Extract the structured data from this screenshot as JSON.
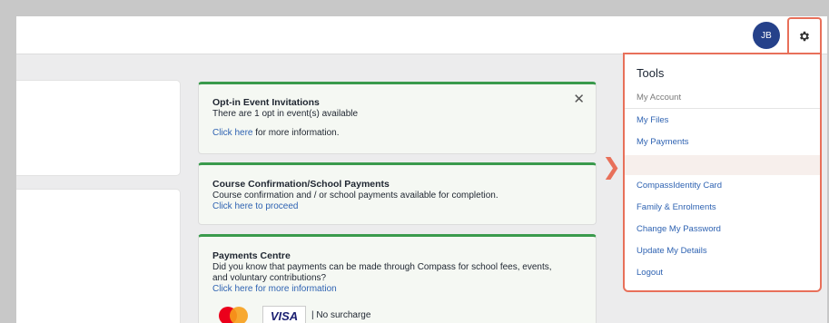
{
  "header": {
    "avatar_initials": "JB",
    "settings_icon": "gear-icon"
  },
  "notices": [
    {
      "title": "Opt-in Event Invitations",
      "body": "There are 1 opt in event(s) available",
      "link": "Click here",
      "link_suffix": " for more information.",
      "close": "✕"
    },
    {
      "title": "Course Confirmation/School Payments",
      "body": "Course confirmation and / or school payments available for completion.",
      "link": "Click here to proceed"
    },
    {
      "title": "Payments Centre",
      "body": "Did you know that payments can be made through Compass for school fees, events, and voluntary contributions?",
      "link": "Click here for more information",
      "card_note": "| No surcharge",
      "visa_label": "VISA"
    }
  ],
  "tools_menu": {
    "title": "Tools",
    "section": "My Account",
    "items": [
      "My Files",
      "My Payments",
      "",
      "CompassIdentity Card",
      "Family & Enrolments",
      "Change My Password",
      "Update My Details",
      "Logout"
    ]
  },
  "colors": {
    "accent": "#e8705a",
    "link": "#2f63b2",
    "notice_border": "#3a9a4c",
    "avatar": "#25418a"
  }
}
